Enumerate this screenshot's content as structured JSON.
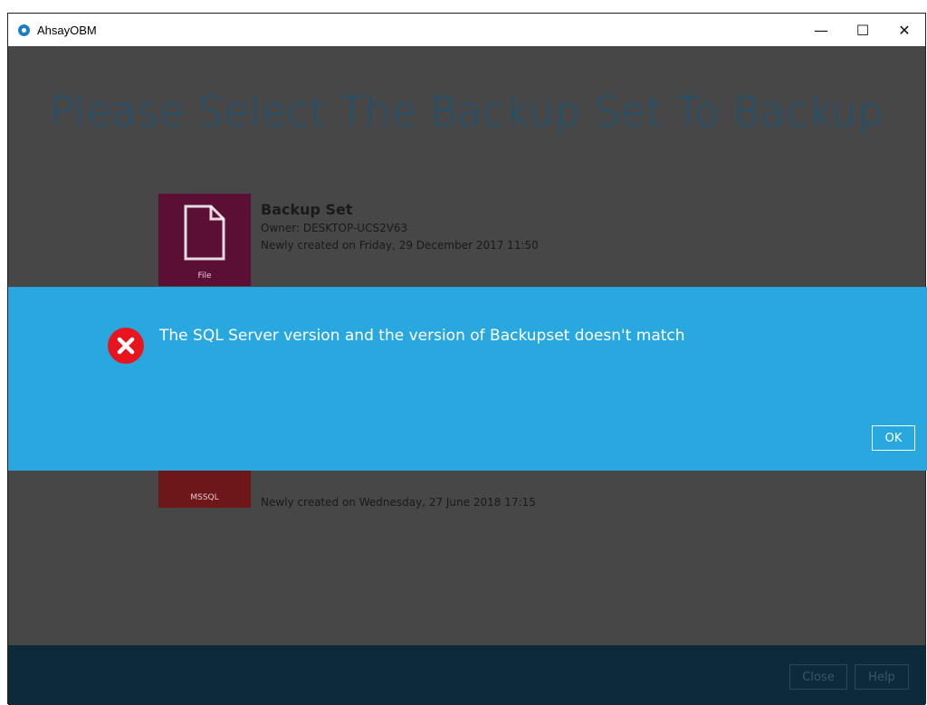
{
  "window": {
    "title": "AhsayOBM",
    "controls": {
      "minimize": "—",
      "maximize": "☐",
      "close": "✕"
    }
  },
  "main": {
    "heading": "Please Select The Backup Set To Backup",
    "backup_sets": [
      {
        "type_label": "File",
        "name": "Backup Set",
        "owner": "Owner: DESKTOP-UCS2V63",
        "created": "Newly created on Friday, 29 December 2017 11:50",
        "tile_color": "#5b0f35"
      },
      {
        "type_label": "MSSQL",
        "created": "Newly created on Wednesday, 27 June 2018 17:15",
        "tile_color": "#6e1719"
      }
    ]
  },
  "dialog": {
    "icon": "error-icon",
    "message": "The SQL Server version and the version of Backupset doesn't match",
    "ok_label": "OK",
    "background": "#28a8df"
  },
  "footer": {
    "close_label": "Close",
    "help_label": "Help"
  }
}
